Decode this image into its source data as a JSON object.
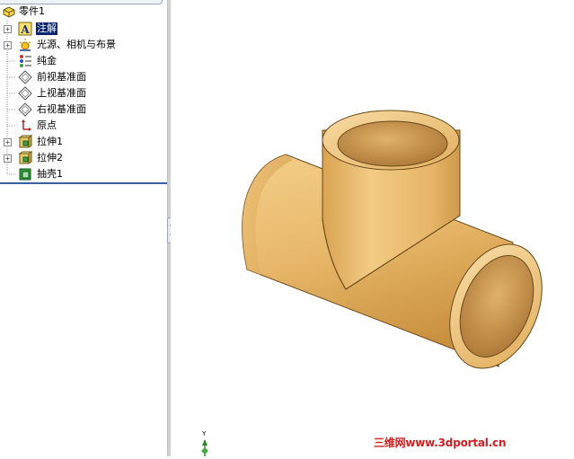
{
  "feature_tree": {
    "part": "零件1",
    "items": [
      {
        "label": "注解",
        "icon": "annotations-icon",
        "expandable": true,
        "selected": true
      },
      {
        "label": "光源、相机与布景",
        "icon": "lights-cameras-scenes-icon",
        "expandable": true,
        "selected": false
      },
      {
        "label": "纯金",
        "icon": "material-icon",
        "expandable": false,
        "selected": false
      },
      {
        "label": "前视基准面",
        "icon": "plane-icon",
        "expandable": false,
        "selected": false
      },
      {
        "label": "上视基准面",
        "icon": "plane-icon",
        "expandable": false,
        "selected": false
      },
      {
        "label": "右视基准面",
        "icon": "plane-icon",
        "expandable": false,
        "selected": false
      },
      {
        "label": "原点",
        "icon": "origin-icon",
        "expandable": false,
        "selected": false
      },
      {
        "label": "拉伸1",
        "icon": "extrude-icon",
        "expandable": true,
        "selected": false
      },
      {
        "label": "拉伸2",
        "icon": "extrude-icon",
        "expandable": true,
        "selected": false
      },
      {
        "label": "抽壳1",
        "icon": "shell-icon",
        "expandable": false,
        "selected": false
      }
    ]
  },
  "viewport": {
    "model": "pipe-tee-icon",
    "triad_axis": "Y",
    "model_color": "#e8b86a"
  },
  "watermark": "三维网www.3dportal.cn"
}
